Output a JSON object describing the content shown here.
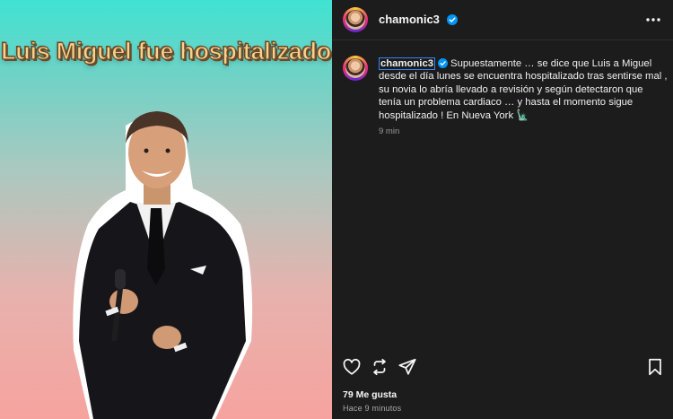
{
  "post": {
    "image_headline": "Luis Miguel fue hospitalizado",
    "username": "chamonic3",
    "caption_text": "Supuestamente … se dice que Luis a Miguel desde el día lunes se encuentra hospitalizado tras sentirse mal , su novia lo abría llevado a revisión y según detectaron que tenía un problema cardiaco … y hasta el momento sigue hospitalizado ! En Nueva York 🗽",
    "caption_time": "9 min",
    "likes": "79 Me gusta",
    "posted_ago": "Hace 9 minutos"
  },
  "icons": {
    "more": "more-horizontal-icon",
    "like": "heart-icon",
    "repost": "repost-icon",
    "share": "send-icon",
    "save": "bookmark-icon",
    "verified": "verified-badge-icon"
  },
  "colors": {
    "panel_bg": "#1c1c1c",
    "verified_blue": "#0095f6",
    "headline_fill": "#f6d38c"
  }
}
